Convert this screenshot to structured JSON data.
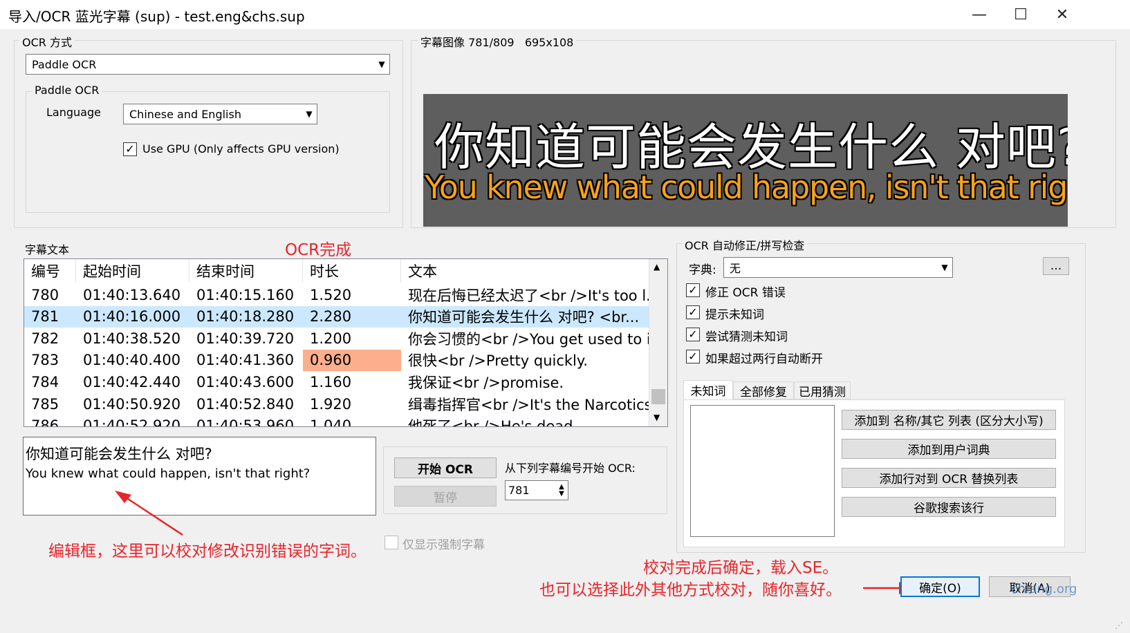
{
  "window": {
    "title": "导入/OCR 蓝光字幕 (sup) - test.eng&chs.sup",
    "minimize_glyph": "—",
    "maximize_glyph": "☐",
    "close_glyph": "✕"
  },
  "ocr_method": {
    "legend": "OCR 方式",
    "engine_value": "Paddle OCR",
    "paddle_group_legend": "Paddle OCR",
    "language_label": "Language",
    "language_value": "Chinese and English",
    "use_gpu_label": "Use GPU (Only affects GPU version)",
    "use_gpu_checked": true
  },
  "subtitle_image": {
    "legend": "字幕图像 781/809   695x108",
    "line_chinese": "你知道可能会发生什么 对吧?",
    "line_english": "You knew what could happen, isn't that right?"
  },
  "subtitle_text": {
    "legend": "字幕文本",
    "columns": [
      "编号",
      "起始时间",
      "结束时间",
      "时长",
      "文本"
    ],
    "rows": [
      {
        "no": "780",
        "start": "01:40:13.640",
        "end": "01:40:15.160",
        "duration": "1.520",
        "text": "现在后悔已经太迟了<br />It's too l..."
      },
      {
        "no": "781",
        "start": "01:40:16.000",
        "end": "01:40:18.280",
        "duration": "2.280",
        "text": "你知道可能会发生什么 对吧? <br..."
      },
      {
        "no": "782",
        "start": "01:40:38.520",
        "end": "01:40:39.720",
        "duration": "1.200",
        "text": "你会习惯的<br />You get used to it."
      },
      {
        "no": "783",
        "start": "01:40:40.400",
        "end": "01:40:41.360",
        "duration": "0.960",
        "text": "很快<br />Pretty quickly."
      },
      {
        "no": "784",
        "start": "01:40:42.440",
        "end": "01:40:43.600",
        "duration": "1.160",
        "text": "我保证<br />promise."
      },
      {
        "no": "785",
        "start": "01:40:50.920",
        "end": "01:40:52.840",
        "duration": "1.920",
        "text": "缉毒指挥官<br />It's the Narcotics..."
      },
      {
        "no": "786",
        "start": "01:40:52.920",
        "end": "01:40:53.960",
        "duration": "1.040",
        "text": "他死了<br />He's dead"
      }
    ],
    "selected_row": 1,
    "warn_row": 3
  },
  "edit_box": {
    "line1": "你知道可能会发生什么 对吧?",
    "line2": "You knew what could happen, isn't that right?"
  },
  "ocr_controls": {
    "start_label": "开始 OCR",
    "pause_label": "暂停",
    "start_from_label": "从下列字幕编号开始 OCR:",
    "start_from_value": "781",
    "forced_only_label": "仅显示强制字幕"
  },
  "autofix": {
    "legend": "OCR 自动修正/拼写检查",
    "dict_label": "字典:",
    "dict_value": "无",
    "browse_label": "...",
    "options": [
      {
        "label": "修正 OCR 错误",
        "checked": true
      },
      {
        "label": "提示未知词",
        "checked": true
      },
      {
        "label": "尝试猜测未知词",
        "checked": true
      },
      {
        "label": "如果超过两行自动断开",
        "checked": true
      }
    ],
    "tabs": [
      "未知词",
      "全部修复",
      "已用猜测"
    ],
    "active_tab": 0,
    "actions": [
      "添加到 名称/其它 列表 (区分大小写)",
      "添加到用户词典",
      "添加行对到 OCR 替换列表",
      "谷歌搜索该行"
    ]
  },
  "footer": {
    "ok_label": "确定(O)",
    "cancel_label": "取消(A)"
  },
  "annotations": {
    "ocr_done": "OCR完成",
    "edit_hint": "编辑框，这里可以校对修改识别错误的字词。",
    "confirm_line1": "校对完成后确定，载入SE。",
    "confirm_line2": "也可以选择此外其他方式校对，随你喜好。",
    "watermark": "chiang.org"
  },
  "colors": {
    "selected_row": "#cce8ff",
    "warn_cell": "#fcae8d",
    "annotation_red": "#e8242b",
    "subtitle_english": "#f7a21b"
  }
}
